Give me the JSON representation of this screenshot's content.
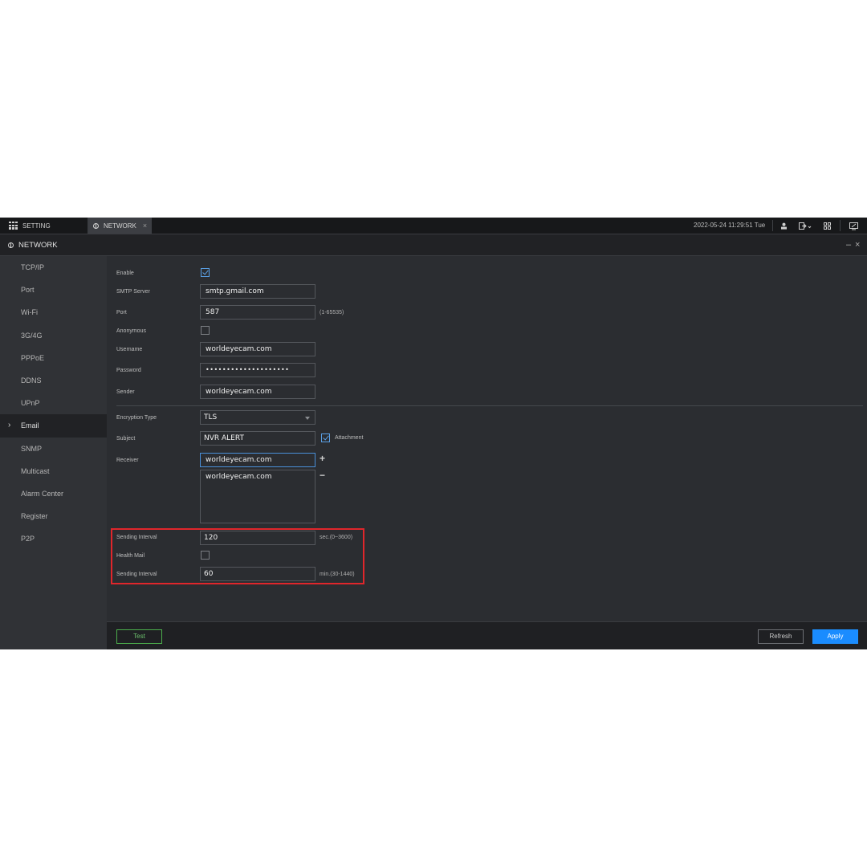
{
  "topbar": {
    "setting_label": "SETTING",
    "network_tab_label": "NETWORK",
    "close_symbol": "×",
    "datetime": "2022-05-24 11:29:51 Tue",
    "icons": [
      "apps-grid-icon",
      "globe-icon",
      "user-icon",
      "logout-icon",
      "layout-icon",
      "monitor-icon"
    ]
  },
  "titlebar": {
    "title": "NETWORK",
    "minimize_symbol": "–",
    "close_symbol": "×"
  },
  "sidebar": {
    "items": [
      {
        "label": "TCP/IP"
      },
      {
        "label": "Port"
      },
      {
        "label": "Wi-Fi"
      },
      {
        "label": "3G/4G"
      },
      {
        "label": "PPPoE"
      },
      {
        "label": "DDNS"
      },
      {
        "label": "UPnP"
      },
      {
        "label": "Email",
        "active": true
      },
      {
        "label": "SNMP"
      },
      {
        "label": "Multicast"
      },
      {
        "label": "Alarm Center"
      },
      {
        "label": "Register"
      },
      {
        "label": "P2P"
      }
    ],
    "active_marker": "›"
  },
  "form": {
    "enable": {
      "label": "Enable",
      "checked": true
    },
    "smtp_server": {
      "label": "SMTP Server",
      "value": "smtp.gmail.com"
    },
    "port": {
      "label": "Port",
      "value": "587",
      "hint": "(1-65535)"
    },
    "anonymous": {
      "label": "Anonymous",
      "checked": false
    },
    "username": {
      "label": "Username",
      "value": "worldeyecam.com"
    },
    "password": {
      "label": "Password",
      "value": "••••••••••••••••••••"
    },
    "sender": {
      "label": "Sender",
      "value": "worldeyecam.com"
    },
    "encryption_type": {
      "label": "Encryption Type",
      "value": "TLS"
    },
    "subject": {
      "label": "Subject",
      "value": "NVR ALERT"
    },
    "attachment": {
      "label": "Attachment",
      "checked": true
    },
    "receiver": {
      "label": "Receiver",
      "value": "worldeyecam.com",
      "list": [
        "worldeyecam.com"
      ],
      "add_symbol": "+",
      "remove_symbol": "−"
    },
    "sending_interval": {
      "label": "Sending Interval",
      "value": "120",
      "hint": "sec.(0~3600)"
    },
    "health_mail": {
      "label": "Health Mail",
      "checked": false
    },
    "health_interval": {
      "label": "Sending Interval",
      "value": "60",
      "hint": "min.(30-1440)"
    }
  },
  "footer": {
    "test_label": "Test",
    "refresh_label": "Refresh",
    "apply_label": "Apply"
  },
  "colors": {
    "highlight": "#e0262b",
    "apply": "#1a8cff",
    "test": "#4cae4c",
    "checkbox": "#5aa0e6"
  }
}
